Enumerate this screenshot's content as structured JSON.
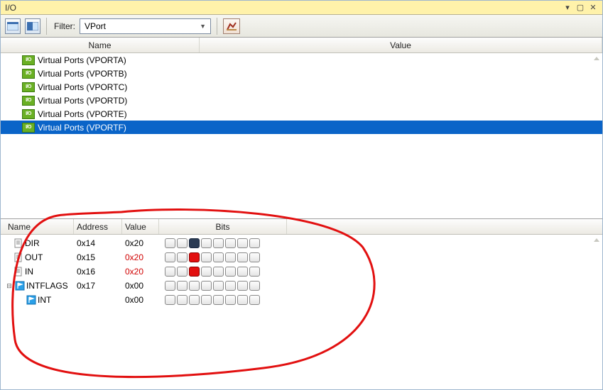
{
  "window": {
    "title": "I/O"
  },
  "toolbar": {
    "filter_label": "Filter:",
    "filter_value": "VPort"
  },
  "top_columns": {
    "name": "Name",
    "value": "Value"
  },
  "ports": [
    {
      "label": "Virtual Ports (VPORTA)",
      "selected": false
    },
    {
      "label": "Virtual Ports (VPORTB)",
      "selected": false
    },
    {
      "label": "Virtual Ports (VPORTC)",
      "selected": false
    },
    {
      "label": "Virtual Ports (VPORTD)",
      "selected": false
    },
    {
      "label": "Virtual Ports (VPORTE)",
      "selected": false
    },
    {
      "label": "Virtual Ports (VPORTF)",
      "selected": true
    }
  ],
  "btm_columns": {
    "name": "Name",
    "address": "Address",
    "value": "Value",
    "bits": "Bits"
  },
  "registers": [
    {
      "name": "DIR",
      "address": "0x14",
      "value": "0x20",
      "value_red": false,
      "icon": "doc",
      "bits": [
        "",
        "",
        "dark",
        "",
        "",
        "",
        "",
        ""
      ],
      "child": false,
      "expander": ""
    },
    {
      "name": "OUT",
      "address": "0x15",
      "value": "0x20",
      "value_red": true,
      "icon": "doc",
      "bits": [
        "",
        "",
        "red",
        "",
        "",
        "",
        "",
        ""
      ],
      "child": false,
      "expander": ""
    },
    {
      "name": "IN",
      "address": "0x16",
      "value": "0x20",
      "value_red": true,
      "icon": "doc",
      "bits": [
        "",
        "",
        "red",
        "",
        "",
        "",
        "",
        ""
      ],
      "child": false,
      "expander": ""
    },
    {
      "name": "INTFLAGS",
      "address": "0x17",
      "value": "0x00",
      "value_red": false,
      "icon": "flag",
      "bits": [
        "",
        "",
        "",
        "",
        "",
        "",
        "",
        ""
      ],
      "child": false,
      "expander": "⊟"
    },
    {
      "name": "INT",
      "address": "",
      "value": "0x00",
      "value_red": false,
      "icon": "flag",
      "bits": [
        "",
        "",
        "",
        "",
        "",
        "",
        "",
        ""
      ],
      "child": true,
      "expander": ""
    }
  ],
  "io_badge": "I/O"
}
